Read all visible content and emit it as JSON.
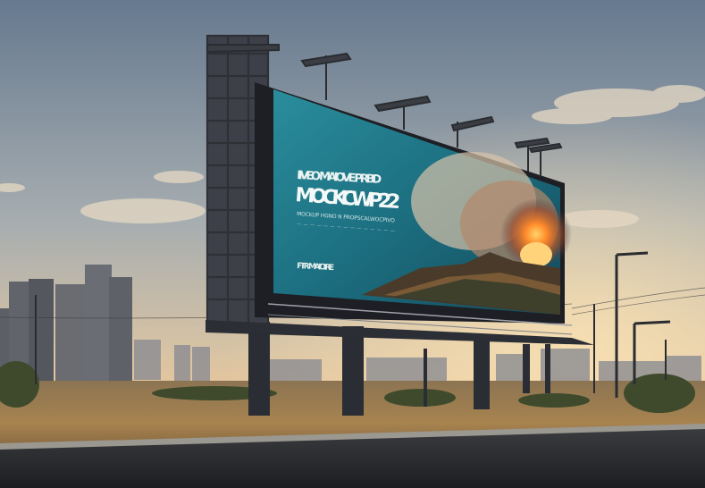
{
  "billboard": {
    "headline_small": "IIVEO MAIOVE PRBD",
    "headline_big": "MOCKCWP22",
    "body_line_1": "MOCKUP HGNO N PROPSCALWOCPIVO",
    "body_line_2": "— — — — — — — — — — — — — — —",
    "footer": "FTR MAIOIRE"
  },
  "colors": {
    "sky_top": "#6c8197",
    "sky_mid": "#b9b6ad",
    "horizon_glow": "#f1c58e",
    "ground": "#9a7b4c",
    "billboard_teal": "#1f6f80",
    "road": "#2a2c30"
  }
}
